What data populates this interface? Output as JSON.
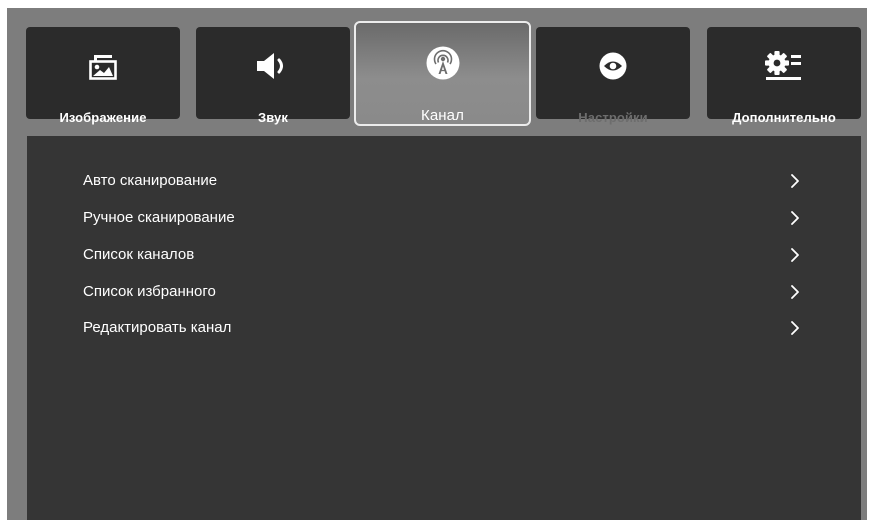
{
  "tabs": [
    {
      "id": "image",
      "label": "Изображение",
      "icon": "image-icon",
      "state": "normal"
    },
    {
      "id": "sound",
      "label": "Звук",
      "icon": "speaker-icon",
      "state": "normal"
    },
    {
      "id": "channel",
      "label": "Канал",
      "icon": "antenna-icon",
      "state": "active"
    },
    {
      "id": "settings",
      "label": "Настройки",
      "icon": "eye-icon",
      "state": "disabled"
    },
    {
      "id": "additional",
      "label": "Дополнительно",
      "icon": "gear-list-icon",
      "state": "normal"
    }
  ],
  "menu": {
    "items": [
      {
        "label": "Авто сканирование",
        "icon": "chevron-right-icon"
      },
      {
        "label": "Ручное сканирование",
        "icon": "chevron-right-icon"
      },
      {
        "label": "Список каналов",
        "icon": "chevron-right-icon"
      },
      {
        "label": "Список избранного",
        "icon": "chevron-right-icon"
      },
      {
        "label": "Редактировать канал",
        "icon": "chevron-right-icon"
      }
    ]
  },
  "colors": {
    "frame": "#7d7d7d",
    "tab_background": "#2b2b2b",
    "panel_background": "#353535",
    "active_border": "#ececec",
    "text": "#ffffff",
    "disabled_text": "#6d6d6d"
  }
}
